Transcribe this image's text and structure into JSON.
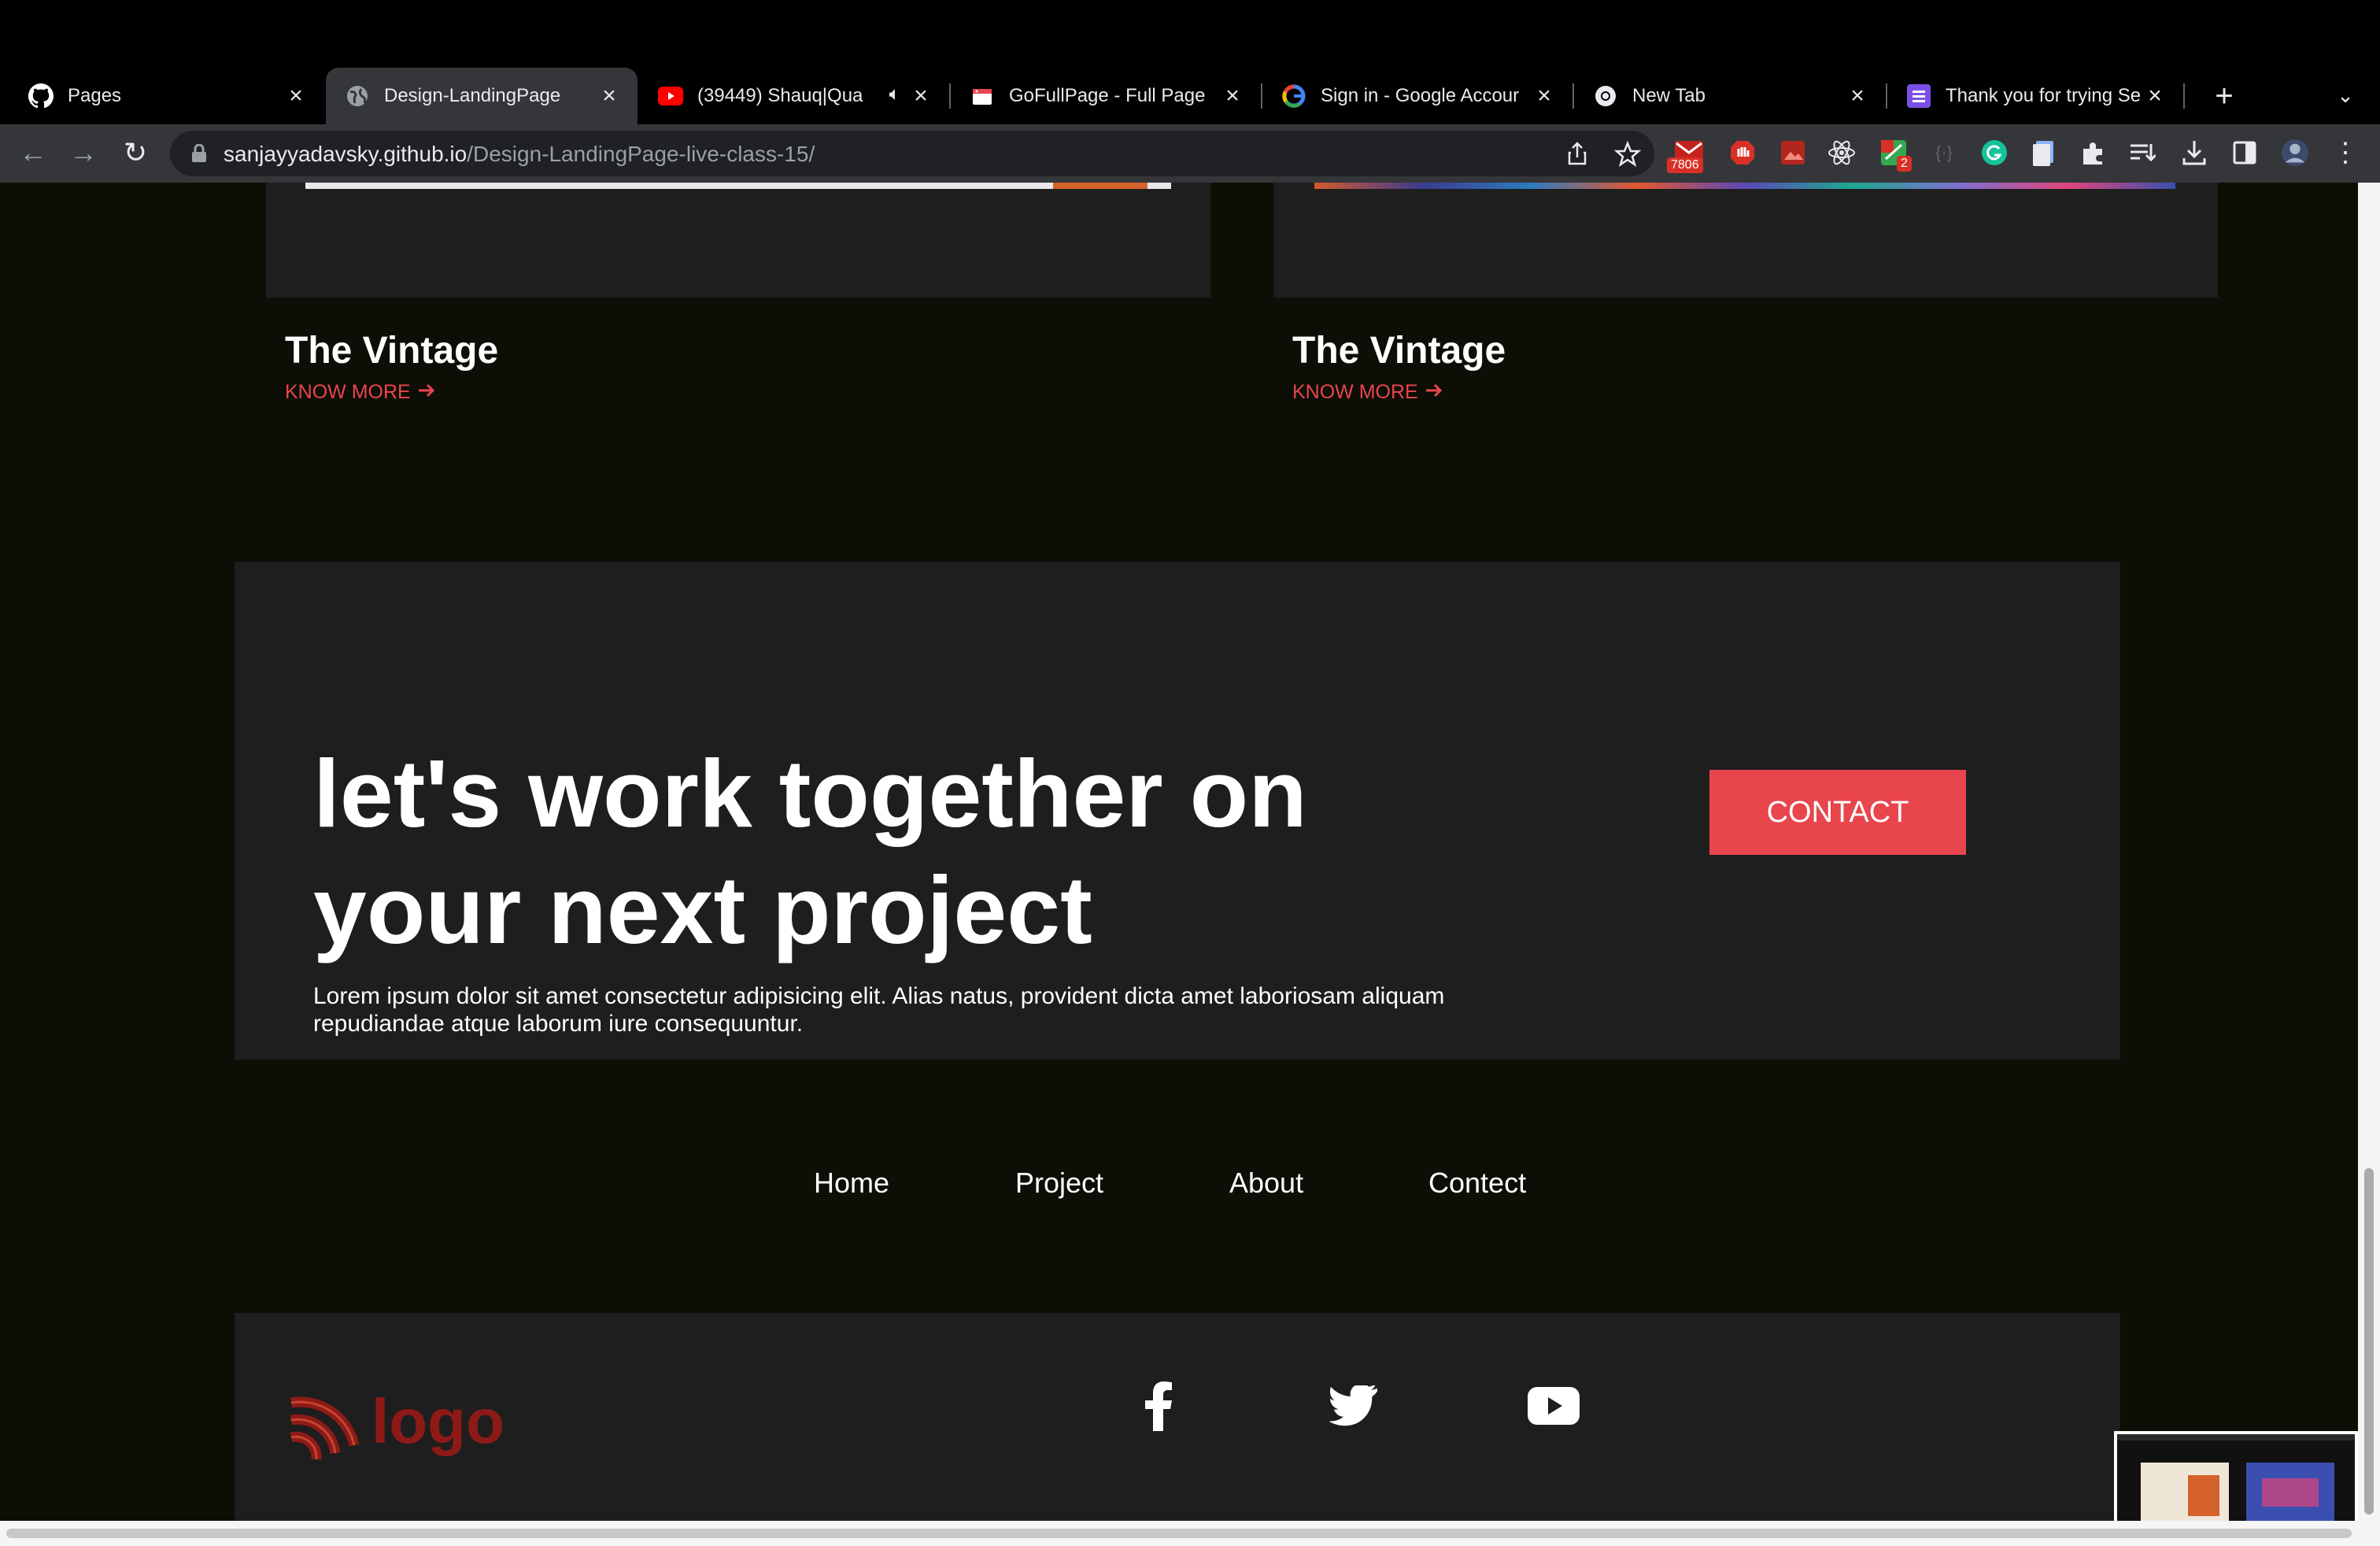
{
  "tabs": [
    {
      "title": "Pages",
      "icon": "github-icon"
    },
    {
      "title": "Design-LandingPage",
      "icon": "globe-icon"
    },
    {
      "title": "(39449) Shauq|Qua",
      "icon": "youtube-icon"
    },
    {
      "title": "GoFullPage - Full Page",
      "icon": "gofullpage-icon"
    },
    {
      "title": "Sign in - Google Accour",
      "icon": "google-icon"
    },
    {
      "title": "New Tab",
      "icon": "chrome-icon"
    },
    {
      "title": "Thank you for trying Se",
      "icon": "list-icon"
    }
  ],
  "address": {
    "domain": "sanjayyadavsky.github.io",
    "path": "/Design-LandingPage-live-class-15/"
  },
  "extensions": {
    "mail_badge": "7806",
    "notif_badge": "2"
  },
  "cards": [
    {
      "title": "The Vintage",
      "link": "KNOW MORE"
    },
    {
      "title": "The Vintage",
      "link": "KNOW MORE"
    }
  ],
  "cta": {
    "title_line1": "let's work together on",
    "title_line2": "your next project",
    "text": "Lorem ipsum dolor sit amet consectetur adipisicing elit. Alias natus, provident dicta amet laboriosam aliquam repudiandae atque laborum iure consequuntur.",
    "button": "CONTACT"
  },
  "nav": [
    "Home",
    "Project",
    "About",
    "Contect"
  ],
  "footer": {
    "logo_text": "logo",
    "social": [
      "facebook-icon",
      "twitter-icon",
      "youtube-icon"
    ]
  },
  "colors": {
    "accent": "#e8454d",
    "page_bg": "#0d0e06",
    "panel_bg": "#1e1e1e"
  }
}
